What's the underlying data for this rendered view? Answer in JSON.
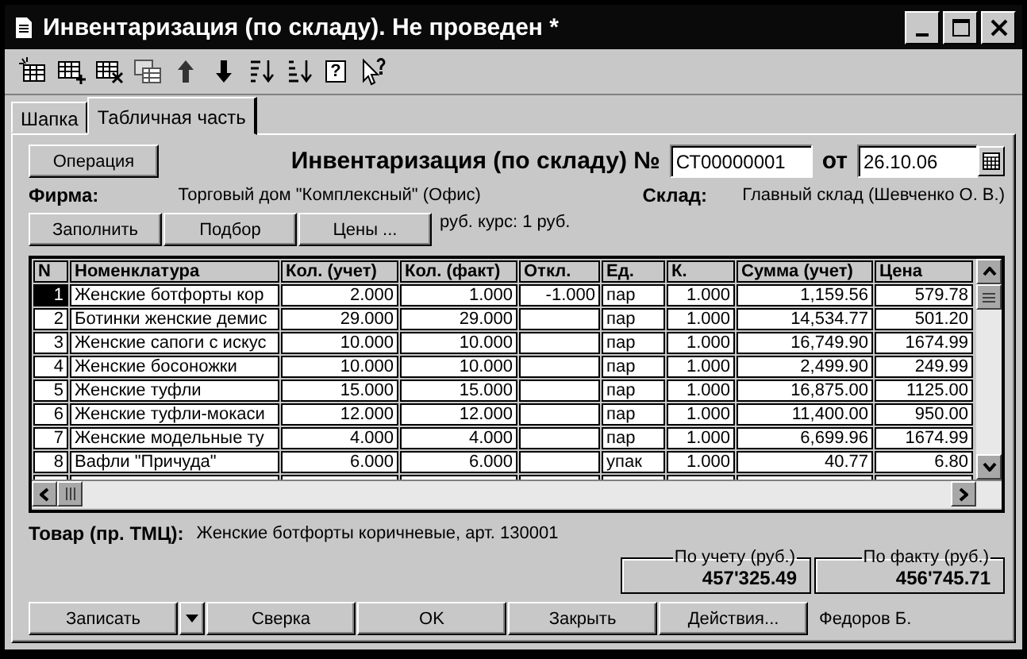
{
  "window": {
    "title": "Инвентаризация (по складу). Не проведен *"
  },
  "toolbar": [
    {
      "kind": "row-new"
    },
    {
      "kind": "row-add"
    },
    {
      "kind": "row-delete"
    },
    {
      "kind": "row-copy"
    },
    {
      "kind": "up"
    },
    {
      "kind": "down"
    },
    {
      "kind": "sort-asc"
    },
    {
      "kind": "sort-desc"
    },
    {
      "kind": "help",
      "glyph": "?"
    },
    {
      "kind": "pointer-help"
    }
  ],
  "tabs": [
    {
      "label": "Шапка",
      "selected": false
    },
    {
      "label": "Табличная часть",
      "selected": true
    }
  ],
  "header": {
    "operation_button": "Операция",
    "doc_title": "Инвентаризация (по складу) №",
    "number": "СТ00000001",
    "date_label": "от",
    "date": "26.10.06",
    "firm_label": "Фирма:",
    "firm": "Торговый дом \"Комплексный\" (Офис)",
    "warehouse_label": "Склад:",
    "warehouse": "Главный склад (Шевченко О. В.)"
  },
  "table_buttons": [
    "Заполнить",
    "Подбор",
    "Цены ..."
  ],
  "rate": "руб. курс: 1 руб.",
  "table": {
    "columns": [
      {
        "label": "N",
        "kind": "number"
      },
      {
        "label": "Номенклатура",
        "kind": "text"
      },
      {
        "label": "Кол. (учет)",
        "kind": "number"
      },
      {
        "label": "Кол. (факт)",
        "kind": "number"
      },
      {
        "label": "Откл.",
        "kind": "number"
      },
      {
        "label": "Ед.",
        "kind": "text"
      },
      {
        "label": "К.",
        "kind": "number"
      },
      {
        "label": "Сумма (учет)",
        "kind": "number"
      },
      {
        "label": "Цена",
        "kind": "number"
      }
    ],
    "rows": [
      {
        "selected": true,
        "cells": [
          "1",
          "Женские ботфорты кор",
          "2.000",
          "1.000",
          "-1.000",
          "пар",
          "1.000",
          "1,159.56",
          "579.78"
        ]
      },
      {
        "selected": false,
        "cells": [
          "2",
          "Ботинки женские демис",
          "29.000",
          "29.000",
          "",
          "пар",
          "1.000",
          "14,534.77",
          "501.20"
        ]
      },
      {
        "selected": false,
        "cells": [
          "3",
          "Женские сапоги с искус",
          "10.000",
          "10.000",
          "",
          "пар",
          "1.000",
          "16,749.90",
          "1674.99"
        ]
      },
      {
        "selected": false,
        "cells": [
          "4",
          "Женские босоножки",
          "10.000",
          "10.000",
          "",
          "пар",
          "1.000",
          "2,499.90",
          "249.99"
        ]
      },
      {
        "selected": false,
        "cells": [
          "5",
          "Женские туфли",
          "15.000",
          "15.000",
          "",
          "пар",
          "1.000",
          "16,875.00",
          "1125.00"
        ]
      },
      {
        "selected": false,
        "cells": [
          "6",
          "Женские туфли-мокаси",
          "12.000",
          "12.000",
          "",
          "пар",
          "1.000",
          "11,400.00",
          "950.00"
        ]
      },
      {
        "selected": false,
        "cells": [
          "7",
          "Женские модельные ту",
          "4.000",
          "4.000",
          "",
          "пар",
          "1.000",
          "6,699.96",
          "1674.99"
        ]
      },
      {
        "selected": false,
        "cells": [
          "8",
          "Вафли \"Причуда\"",
          "6.000",
          "6.000",
          "",
          "упак",
          "1.000",
          "40.77",
          "6.80"
        ]
      }
    ]
  },
  "product": {
    "label": "Товар (пр. ТМЦ):",
    "value": "Женские ботфорты коричневые, арт. 130001"
  },
  "totals": [
    {
      "label": "По учету (руб.)",
      "value": "457'325.49"
    },
    {
      "label": "По факту (руб.)",
      "value": "456'745.71"
    }
  ],
  "footer_buttons": [
    {
      "kind": "button",
      "label": "Записать"
    },
    {
      "kind": "dropdown"
    },
    {
      "kind": "button",
      "label": "Сверка"
    },
    {
      "kind": "button",
      "label": "OK"
    },
    {
      "kind": "button",
      "label": "Закрыть"
    },
    {
      "kind": "button",
      "label": "Действия..."
    }
  ],
  "user": "Федоров Б."
}
